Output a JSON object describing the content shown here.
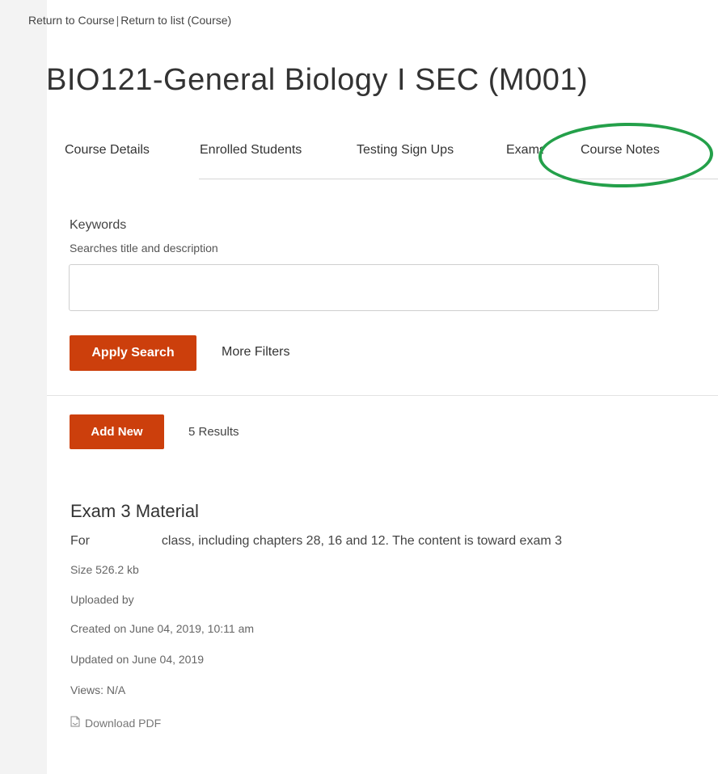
{
  "breadcrumb": {
    "return_course": "Return to Course",
    "separator": "|",
    "return_list": "Return to list (Course)"
  },
  "page_title": "BIO121-General Biology I SEC (M001)",
  "tabs": [
    {
      "label": "Course Details"
    },
    {
      "label": "Enrolled Students"
    },
    {
      "label": "Testing Sign Ups"
    },
    {
      "label": "Exams"
    },
    {
      "label": "Course Notes",
      "active": true
    }
  ],
  "search": {
    "keywords_label": "Keywords",
    "keywords_help": "Searches title and description",
    "keywords_value": "",
    "keywords_placeholder": "",
    "apply_label": "Apply Search",
    "more_filters_label": "More Filters"
  },
  "results": {
    "add_label": "Add New",
    "count_text": "5 Results"
  },
  "item": {
    "title": "Exam 3 Material",
    "desc_prefix": "For",
    "desc_rest": "class, including chapters 28, 16 and 12. The content is toward exam 3",
    "size": "Size 526.2 kb",
    "uploaded_by": "Uploaded by",
    "created": "Created on June 04, 2019, 10:11 am",
    "updated": "Updated on June 04, 2019",
    "views": "Views: N/A",
    "download_label": "Download PDF"
  },
  "colors": {
    "primary": "#cc3f0c",
    "highlight_ring": "#24a04a"
  },
  "icons": {
    "download": "document-icon"
  }
}
